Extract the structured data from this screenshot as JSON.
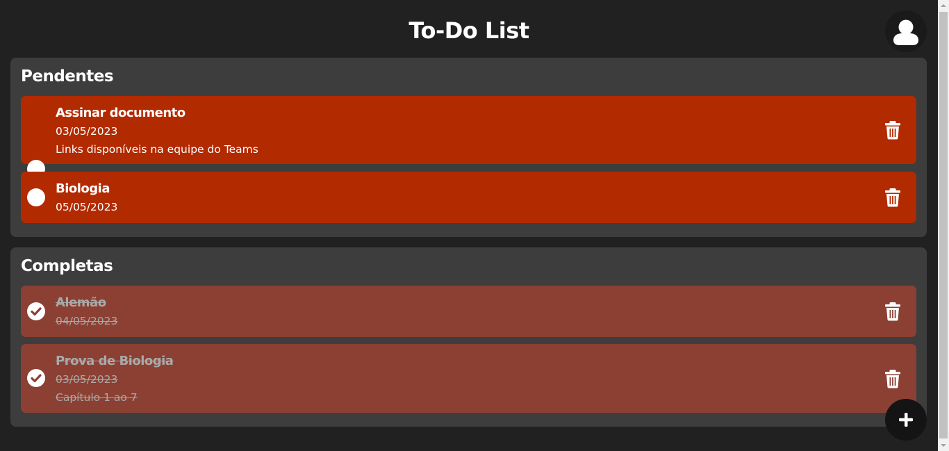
{
  "header": {
    "title": "To-Do List",
    "avatar_icon": "user-avatar-icon"
  },
  "pending": {
    "title": "Pendentes",
    "tasks": [
      {
        "title": "Assinar documento",
        "date": "03/05/2023",
        "description": "Links disponíveis na equipe do Teams",
        "completed": false
      },
      {
        "title": "Biologia",
        "date": "05/05/2023",
        "description": "",
        "completed": false
      }
    ]
  },
  "completed": {
    "title": "Completas",
    "tasks": [
      {
        "title": "Alemão",
        "date": "04/05/2023",
        "description": "",
        "completed": true
      },
      {
        "title": "Prova de Biologia",
        "date": "03/05/2023",
        "description": "Capítulo 1 ao 7",
        "completed": true
      }
    ]
  },
  "actions": {
    "add_icon": "plus-icon",
    "delete_icon": "trash-icon"
  },
  "colors": {
    "background": "#212121",
    "section_bg": "#3d3d3d",
    "pending_task": "#b22a00",
    "completed_task": "#8b4033",
    "completed_text": "#a9a9a9"
  }
}
